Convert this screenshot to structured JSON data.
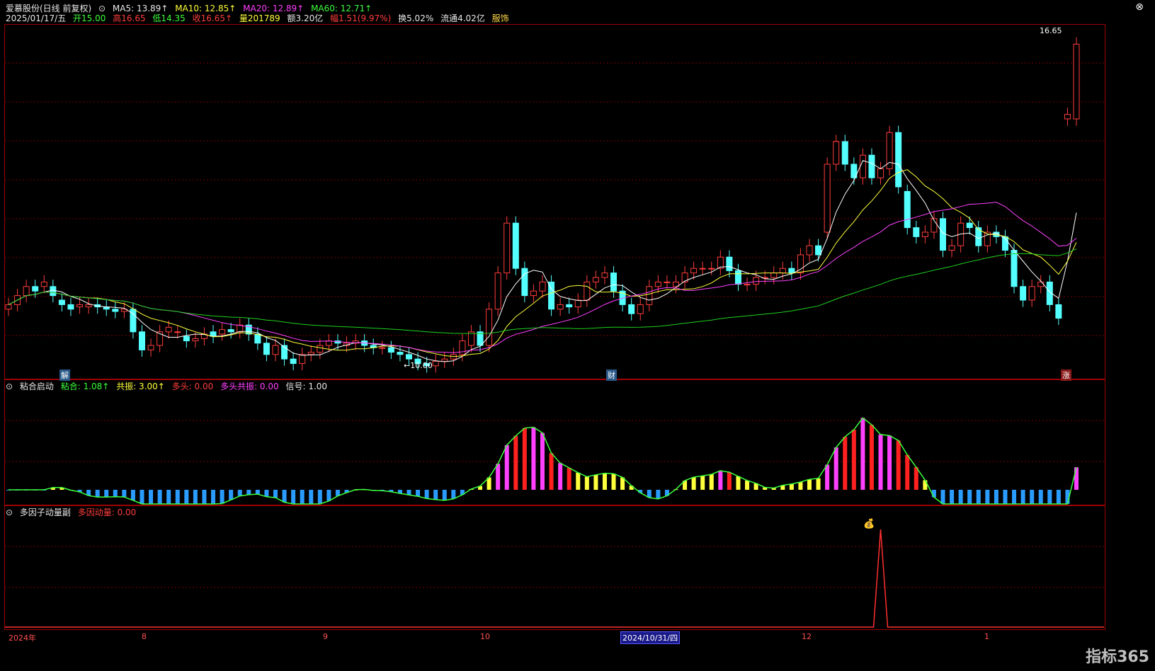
{
  "header": {
    "title": "爱慕股份(日线 前复权)",
    "ma5": "MA5: 13.89↑",
    "ma10": "MA10: 12.85↑",
    "ma20": "MA20: 12.89↑",
    "ma60": "MA60: 12.71↑",
    "date": "2025/01/17/五",
    "open": "开15.00",
    "high": "高16.65",
    "low": "低14.35",
    "close": "收16.65↑",
    "volume": "量201789",
    "amount": "额3.20亿",
    "change": "幅1.51(9.97%)",
    "turnover": "换5.02%",
    "float": "流通4.02亿",
    "sector": "服饰"
  },
  "main_chart": {
    "max_label": "16.65",
    "min_label": "←10.00",
    "tags": [
      "解",
      "财",
      "涨"
    ]
  },
  "sub1": {
    "title": "粘合启动",
    "stick": "粘合: 1.08↑",
    "res": "共振: 3.00↑",
    "bull": "多头: 0.00",
    "bullres": "多头共振: 0.00",
    "signal": "信号: 1.00"
  },
  "sub2": {
    "title": "多因子动量副",
    "momentum": "多因动量: 0.00"
  },
  "xaxis": {
    "labels": [
      "2024年",
      "8",
      "9",
      "10",
      "2024/10/31/四",
      "12",
      "1"
    ]
  },
  "brand": "指标365",
  "colors": {
    "up": "#ff3c3c",
    "down": "#54ffff",
    "ma5": "#ffffff",
    "ma10": "#ffff3c",
    "ma20": "#ff40ff",
    "ma60": "#1fd11f",
    "grid": "#7a0000"
  },
  "chart_data": {
    "type": "candlestick",
    "closes": [
      10.9,
      11.1,
      11.3,
      11.2,
      11.4,
      11.1,
      10.9,
      10.8,
      10.9,
      10.9,
      10.85,
      10.8,
      10.75,
      10.8,
      10.3,
      9.9,
      10.0,
      10.3,
      10.4,
      10.3,
      10.1,
      10.15,
      10.25,
      10.2,
      10.35,
      10.3,
      10.45,
      10.25,
      10.05,
      9.8,
      10.0,
      9.7,
      9.6,
      9.8,
      9.85,
      10.0,
      10.1,
      10.05,
      10.05,
      10.1,
      10.0,
      9.95,
      9.95,
      9.85,
      9.8,
      9.7,
      9.6,
      9.55,
      9.65,
      9.7,
      9.8,
      10.1,
      10.3,
      10.0,
      10.8,
      11.6,
      12.7,
      11.7,
      11.1,
      11.2,
      11.4,
      10.8,
      10.9,
      10.85,
      11.0,
      11.4,
      11.5,
      11.6,
      11.2,
      10.9,
      10.7,
      10.9,
      11.3,
      11.4,
      11.4,
      11.4,
      11.6,
      11.7,
      11.7,
      11.7,
      11.95,
      11.65,
      11.35,
      11.35,
      11.5,
      11.5,
      11.6,
      11.7,
      11.6,
      12.0,
      12.2,
      12.0,
      14.0,
      14.5,
      14.0,
      13.7,
      14.2,
      13.7,
      13.9,
      14.7,
      13.5,
      12.6,
      12.4,
      12.5,
      12.8,
      12.1,
      12.2,
      12.7,
      12.6,
      12.2,
      12.5,
      12.4,
      12.1,
      11.3,
      11.0,
      11.3,
      11.4,
      10.9,
      10.6,
      15.1,
      16.65
    ],
    "opens": [
      10.8,
      10.9,
      11.1,
      11.3,
      11.3,
      11.3,
      11.0,
      10.9,
      10.85,
      10.85,
      10.9,
      10.85,
      10.8,
      10.75,
      10.8,
      10.3,
      9.9,
      10.0,
      10.3,
      10.3,
      10.2,
      10.1,
      10.15,
      10.3,
      10.25,
      10.35,
      10.3,
      10.45,
      10.25,
      10.05,
      9.8,
      10.0,
      9.7,
      9.6,
      9.8,
      9.85,
      10.0,
      10.1,
      10.0,
      10.05,
      10.1,
      10.0,
      9.95,
      9.95,
      9.85,
      9.8,
      9.7,
      9.6,
      9.55,
      9.65,
      9.7,
      9.8,
      10.0,
      10.3,
      10.0,
      10.8,
      11.6,
      12.7,
      11.7,
      11.1,
      11.2,
      11.4,
      10.8,
      10.9,
      10.85,
      11.0,
      11.4,
      11.5,
      11.6,
      11.2,
      10.9,
      10.7,
      10.9,
      11.3,
      11.4,
      11.3,
      11.4,
      11.6,
      11.7,
      11.7,
      11.7,
      11.95,
      11.65,
      11.35,
      11.35,
      11.5,
      11.5,
      11.6,
      11.7,
      11.6,
      12.0,
      12.2,
      12.5,
      14.0,
      14.5,
      14.0,
      13.7,
      14.2,
      13.7,
      13.9,
      14.7,
      13.4,
      12.6,
      12.4,
      12.5,
      12.8,
      12.1,
      12.2,
      12.7,
      12.6,
      12.2,
      12.5,
      12.4,
      12.1,
      11.3,
      11.0,
      11.3,
      11.4,
      10.9,
      15.0,
      15.0
    ]
  }
}
